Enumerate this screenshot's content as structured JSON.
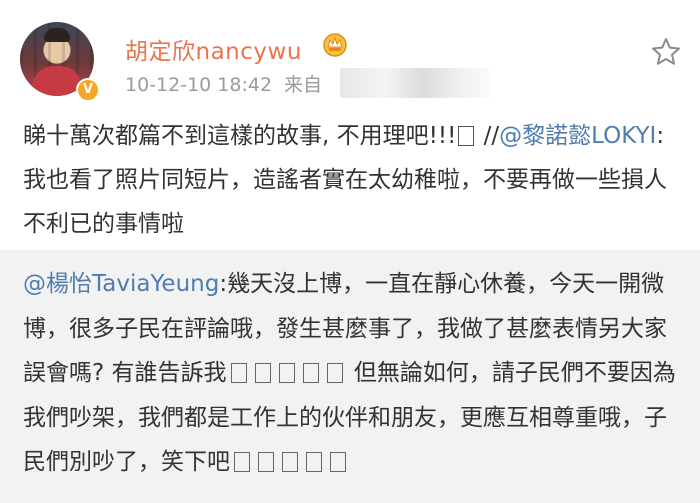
{
  "post": {
    "author": {
      "name": "胡定欣nancywu",
      "verified": true,
      "badge_color": "#f5a623"
    },
    "timestamp": "10-12-10 18:42",
    "source_label": "来自",
    "text_part1": "睇十萬次都篇不到這樣的故事, 不用理吧!!!",
    "text_sep": " //",
    "mention": "@黎諾懿LOKYI",
    "text_part2": ":我也看了照片同短片，造謠者實在太幼稚啦，不要再做一些損人不利已的事情啦"
  },
  "repost": {
    "mention": "@楊怡TaviaYeung",
    "text_part1": ":幾天沒上博，一直在靜心休養，今天一開微博，很多子民在評論哦，發生甚麼事了，我做了甚麼表情另大家誤會嗎? 有誰告訴我",
    "text_part2": " 但無論如何，請子民們不要因為我們吵架，我們都是工作上的伙伴和朋友，更應互相尊重哦，子民們別吵了，笑下吧"
  },
  "colors": {
    "name": "#eb7350",
    "mention": "#507daf",
    "text": "#333333",
    "meta": "#9b9b9b",
    "repost_bg": "#f2f2f2"
  },
  "icons": [
    "vip-crown-icon",
    "star-icon",
    "verified-icon"
  ]
}
